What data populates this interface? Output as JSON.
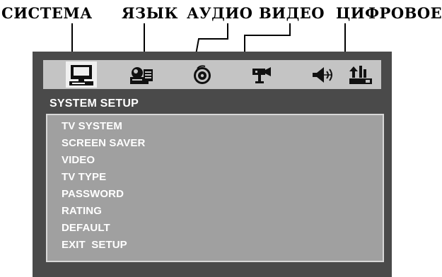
{
  "callouts": {
    "system": "СИСТЕМА",
    "language": "ЯЗЫК",
    "audio": "АУДИО",
    "video": "ВИДЕО",
    "digital": "ЦИФРОВОЕ"
  },
  "icons": [
    "monitor-icon",
    "language-icon",
    "audio-disc-icon",
    "video-camera-icon",
    "speaker-icon",
    "digital-icon"
  ],
  "selected_icon": "monitor-icon",
  "menu": {
    "title": "SYSTEM SETUP",
    "items": [
      "TV SYSTEM",
      "SCREEN SAVER",
      "VIDEO",
      "TV TYPE",
      "PASSWORD",
      "RATING",
      "DEFAULT",
      "EXIT  SETUP"
    ]
  },
  "colors": {
    "frame": "#4a4a4a",
    "icon_bar": "#c4c4c4",
    "panel": "#a0a0a0",
    "text": "#ffffff"
  }
}
